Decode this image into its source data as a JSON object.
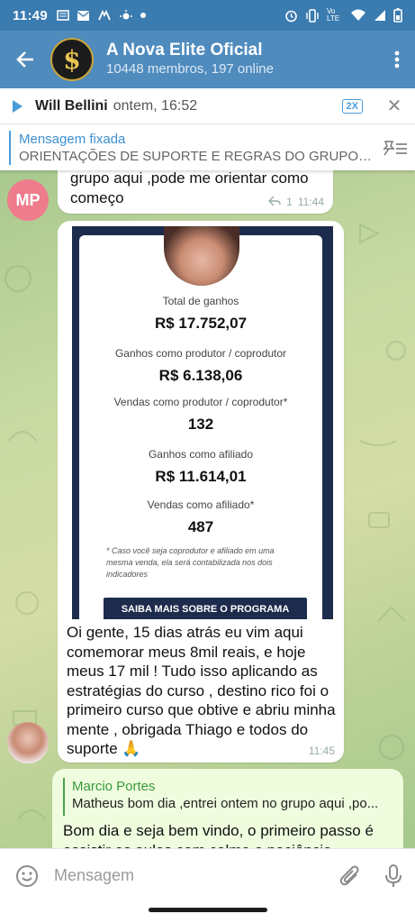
{
  "status_bar": {
    "time": "11:49",
    "left_icons": [
      "news-icon",
      "mail-icon",
      "hands-icon",
      "sun-icon",
      "dot-icon"
    ],
    "right_icons": [
      "alarm-icon",
      "vibrate-icon",
      "volte-icon",
      "wifi-icon",
      "signal-icon",
      "battery-icon"
    ],
    "volte_text": "Vo LTE"
  },
  "header": {
    "title": "A Nova Elite Oficial",
    "subtitle": "10448 membros, 197 online",
    "avatar_glyph": "$"
  },
  "voice_bar": {
    "author": "Will Bellini",
    "time": "ontem, 16:52",
    "speed": "2X"
  },
  "pinned": {
    "title": "Mensagem fixada",
    "text": "ORIENTAÇÕES DE SUPORTE E REGRAS DO GRUPO 🚀..."
  },
  "messages": {
    "first": {
      "avatar_initials": "MP",
      "text": "grupo aqui ,pode me orientar como começo",
      "reply_count": "1",
      "time": "11:44"
    },
    "second": {
      "screenshot": {
        "total_label": "Total de ganhos",
        "total_value": "R$ 17.752,07",
        "producer_label": "Ganhos como produtor / coprodutor",
        "producer_value": "R$ 6.138,06",
        "sales_producer_label": "Vendas como produtor / coprodutor*",
        "sales_producer_value": "132",
        "affiliate_label": "Ganhos como afiliado",
        "affiliate_value": "R$ 11.614,01",
        "sales_affiliate_label": "Vendas como afiliado*",
        "sales_affiliate_value": "487",
        "note": "* Caso você seja coprodutor e afiliado em uma mesma venda, ela será contabilizada nos dois indicadores",
        "cta": "SAIBA MAIS SOBRE O PROGRAMA"
      },
      "text": "Oi gente, 15 dias atrás eu vim aqui comemorar meus 8mil reais, e hoje meus 17 mil ! Tudo isso aplicando as estratégias do curso , destino rico foi o primeiro curso que obtive e abriu minha mente , obrigada Thiago e todos do suporte 🙏",
      "time": "11:45"
    },
    "third": {
      "reply_author": "Marcio Portes",
      "reply_text": "Matheus bom dia ,entrei ontem no grupo aqui ,po...",
      "text": "Bom dia e seja bem vindo, o primeiro passo é assistir as aulas com calma e paciência"
    }
  },
  "input": {
    "placeholder": "Mensagem"
  },
  "colors": {
    "header": "#4f8bbd",
    "status_bar": "#3a7bb0",
    "accent": "#4a9bd6",
    "outgoing_bubble": "#effdde"
  }
}
